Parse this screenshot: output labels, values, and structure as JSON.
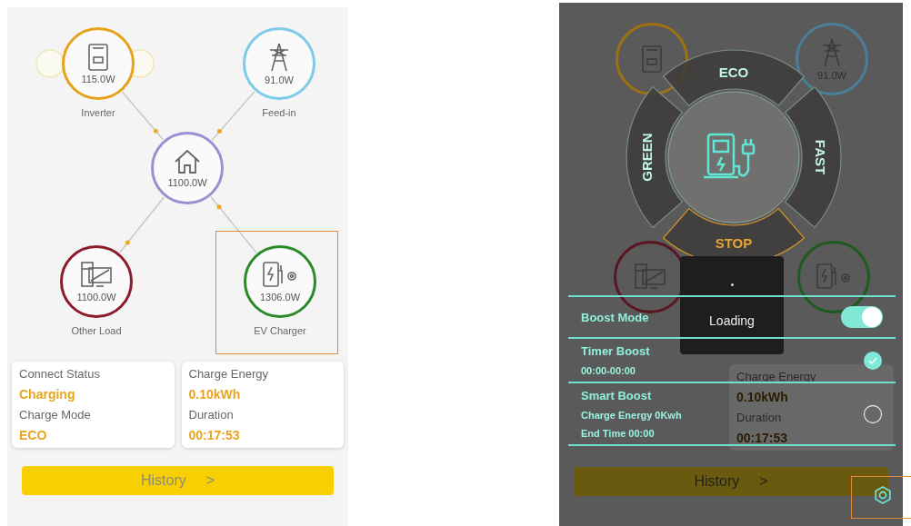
{
  "left_screen": {
    "nodes": [
      {
        "kind": "inverter",
        "value": "115.0W",
        "label": "Inverter",
        "color": "#e6a21a"
      },
      {
        "kind": "grid",
        "value": "91.0W",
        "label": "Feed-in",
        "color": "#7ccbe8"
      },
      {
        "kind": "home",
        "value": "1100.0W",
        "color": "#9b8fd1"
      },
      {
        "kind": "load",
        "value": "1100.0W",
        "label": "Other Load",
        "color": "#8c1c2c"
      },
      {
        "kind": "charger",
        "value": "1306.0W",
        "label": "EV Charger",
        "color": "#2a8a2a"
      }
    ],
    "status_cards": [
      {
        "items": [
          {
            "label": "Connect Status",
            "value": "Charging"
          },
          {
            "label": "Charge Mode",
            "value": "ECO"
          }
        ]
      },
      {
        "items": [
          {
            "label": "Charge Energy",
            "value": "0.10kWh"
          },
          {
            "label": "Duration",
            "value": "00:17:53"
          }
        ]
      }
    ],
    "history_button": {
      "label": "History",
      "arrow": ">"
    }
  },
  "right_screen": {
    "background": {
      "nodes": [
        {
          "kind": "inverter",
          "color": "#a0720f"
        },
        {
          "kind": "grid",
          "color": "#4a7f99",
          "value": "91.0W"
        },
        {
          "kind": "load",
          "color": "#5a1520"
        },
        {
          "kind": "charger",
          "color": "#1d5a1d"
        }
      ],
      "status_card": {
        "items": [
          {
            "label": "Charge Energy",
            "value": "0.10kWh"
          },
          {
            "label": "Duration",
            "value": "00:17:53"
          }
        ]
      },
      "history_button": {
        "label": "History",
        "arrow": ">"
      }
    },
    "mode_wheel": {
      "modes": [
        {
          "label": "ECO",
          "selected": false
        },
        {
          "label": "FAST",
          "selected": false
        },
        {
          "label": "STOP",
          "selected": true
        },
        {
          "label": "GREEN",
          "selected": false
        }
      ]
    },
    "loading": {
      "label": "Loading"
    },
    "boost": {
      "mode": {
        "label": "Boost Mode",
        "on": true
      },
      "options": [
        {
          "title": "Timer Boost",
          "details": [
            "00:00-00:00"
          ],
          "checked": true
        },
        {
          "title": "Smart Boost",
          "details": [
            "Charge Energy 0Kwh",
            "End Time 00:00"
          ],
          "checked": false
        }
      ]
    }
  }
}
